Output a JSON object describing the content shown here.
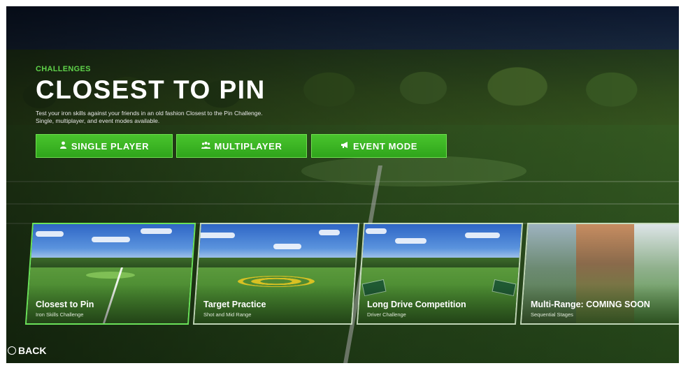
{
  "header": {
    "eyebrow": "CHALLENGES",
    "title": "CLOSEST TO PIN",
    "description": "Test your iron skills against your friends in an old fashion Closest to the Pin Challenge. Single, multiplayer, and event modes available."
  },
  "modes": [
    {
      "label": "SINGLE PLAYER",
      "icon": "person-icon"
    },
    {
      "label": "MULTIPLAYER",
      "icon": "group-icon"
    },
    {
      "label": "EVENT MODE",
      "icon": "megaphone-icon"
    }
  ],
  "cards": [
    {
      "title": "Closest to Pin",
      "subtitle": "Iron Skills Challenge",
      "selected": true
    },
    {
      "title": "Target Practice",
      "subtitle": "Shot and Mid Range",
      "selected": false
    },
    {
      "title": "Long Drive Competition",
      "subtitle": "Driver Challenge",
      "selected": false
    },
    {
      "title": "Multi-Range: COMING SOON",
      "subtitle": "Sequential Stages",
      "selected": false
    }
  ],
  "footer": {
    "back_label": "BACK",
    "back_icon": "circle-button-icon"
  },
  "colors": {
    "accent": "#3fb826",
    "eyebrow": "#5fd24a"
  }
}
